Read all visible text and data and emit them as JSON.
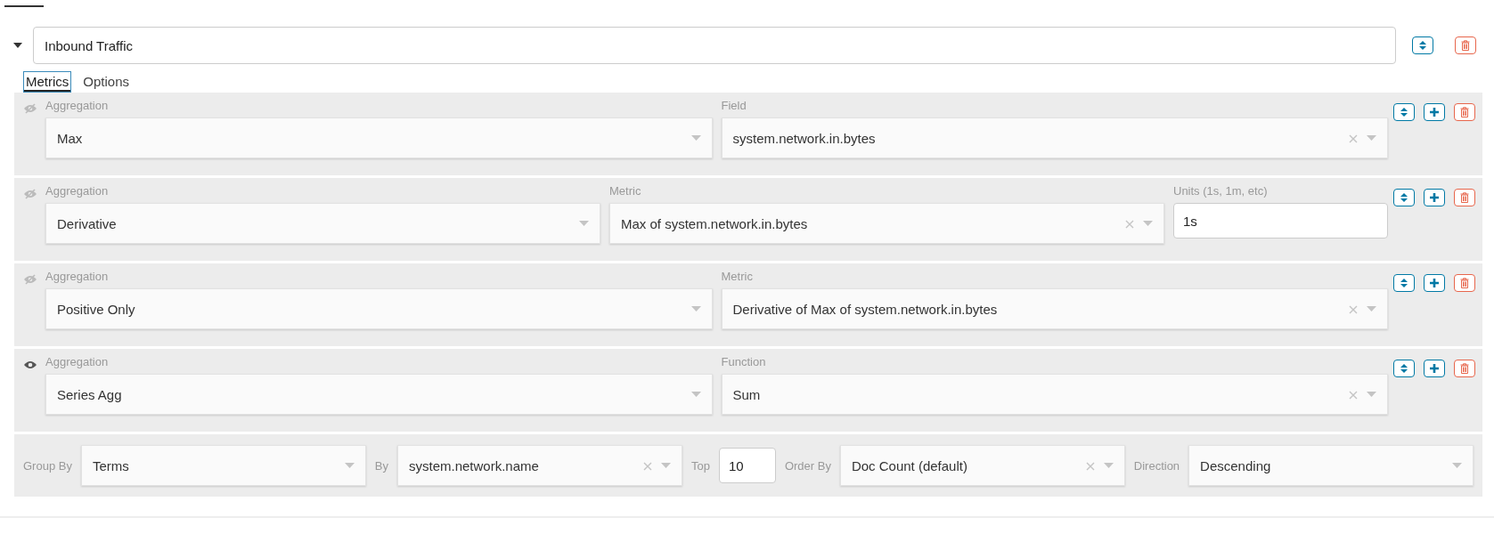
{
  "header": {
    "expanded": true,
    "title": "Inbound Traffic"
  },
  "tabs": [
    {
      "label": "Metrics",
      "selected": true
    },
    {
      "label": "Options",
      "selected": false
    }
  ],
  "metrics": [
    {
      "visible": false,
      "fields": [
        {
          "kind": "select",
          "label": "Aggregation",
          "value": "Max",
          "clearable": false
        },
        {
          "kind": "select",
          "label": "Field",
          "value": "system.network.in.bytes",
          "clearable": true
        }
      ]
    },
    {
      "visible": false,
      "fields": [
        {
          "kind": "select",
          "label": "Aggregation",
          "value": "Derivative",
          "clearable": false
        },
        {
          "kind": "select",
          "label": "Metric",
          "value": "Max of system.network.in.bytes",
          "clearable": true
        },
        {
          "kind": "input",
          "label": "Units (1s, 1m, etc)",
          "value": "1s"
        }
      ]
    },
    {
      "visible": false,
      "fields": [
        {
          "kind": "select",
          "label": "Aggregation",
          "value": "Positive Only",
          "clearable": false
        },
        {
          "kind": "select",
          "label": "Metric",
          "value": "Derivative of Max of system.network.in.bytes",
          "clearable": true
        }
      ]
    },
    {
      "visible": true,
      "fields": [
        {
          "kind": "select",
          "label": "Aggregation",
          "value": "Series Agg",
          "clearable": false
        },
        {
          "kind": "select",
          "label": "Function",
          "value": "Sum",
          "clearable": true
        }
      ]
    }
  ],
  "group_by": [
    {
      "kind": "select",
      "label": "Group By",
      "value": "Terms",
      "clearable": false
    },
    {
      "kind": "select",
      "label": "By",
      "value": "system.network.name",
      "clearable": true
    },
    {
      "kind": "input",
      "label": "Top",
      "value": "10"
    },
    {
      "kind": "select",
      "label": "Order By",
      "value": "Doc Count (default)",
      "clearable": true
    },
    {
      "kind": "select",
      "label": "Direction",
      "value": "Descending",
      "clearable": false
    }
  ]
}
